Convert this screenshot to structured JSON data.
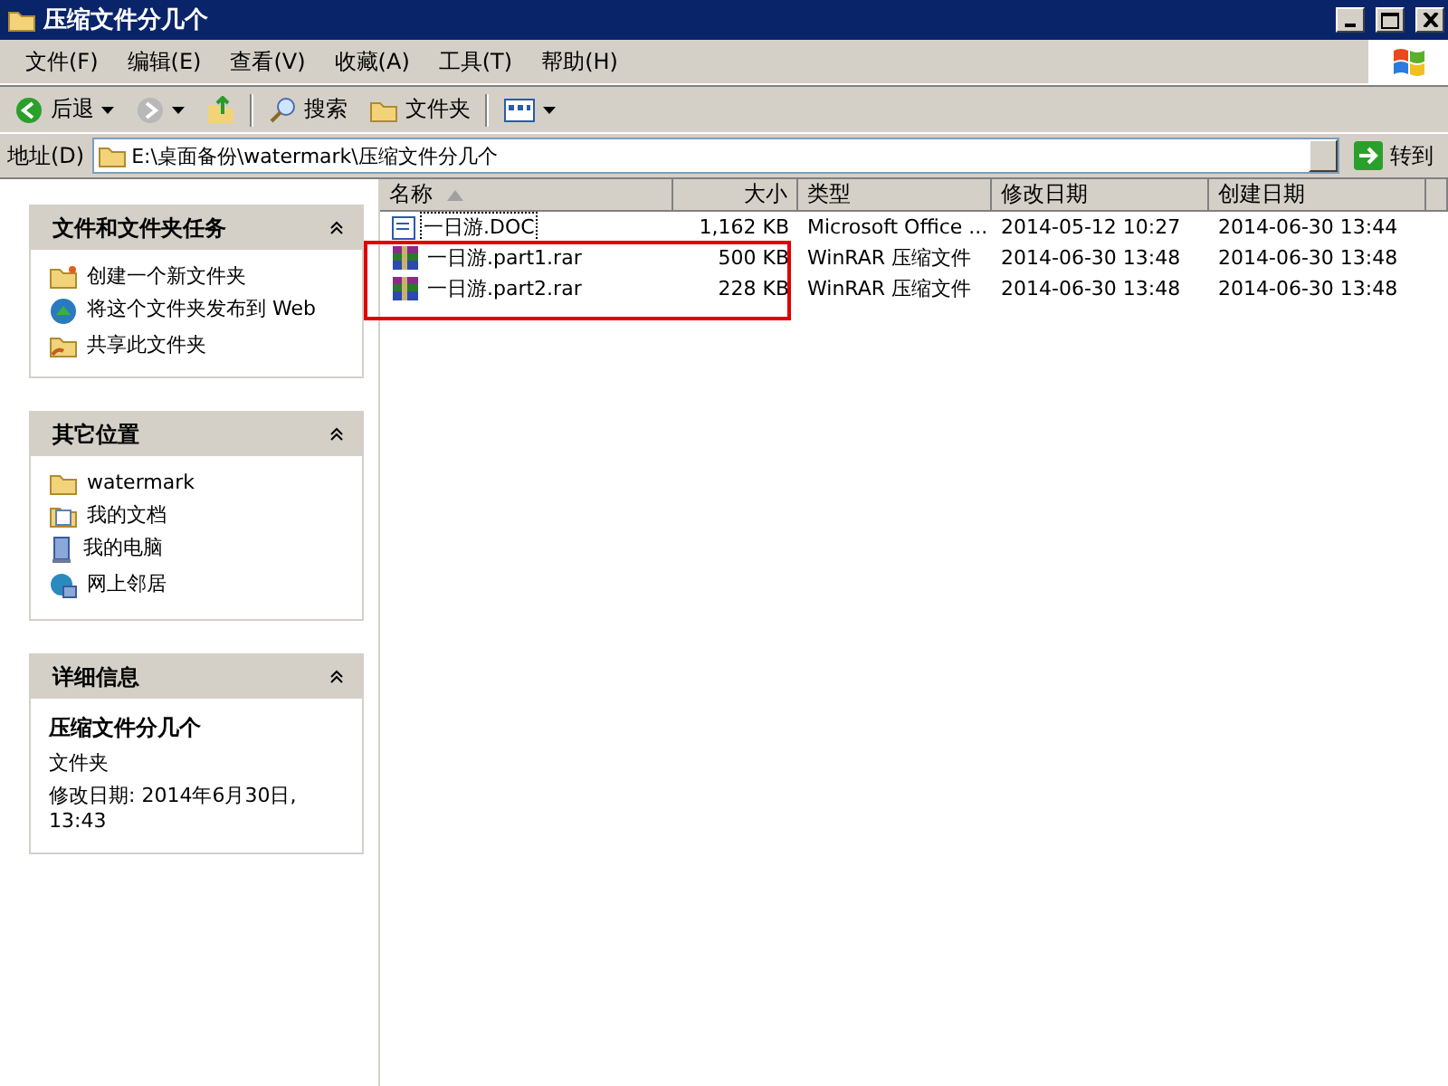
{
  "window": {
    "title": "压缩文件分几个"
  },
  "menu": [
    "文件(F)",
    "编辑(E)",
    "查看(V)",
    "收藏(A)",
    "工具(T)",
    "帮助(H)"
  ],
  "toolbar": {
    "back": "后退",
    "search": "搜索",
    "folders": "文件夹"
  },
  "address": {
    "label": "地址(D)",
    "value": "E:\\桌面备份\\watermark\\压缩文件分几个",
    "go": "转到"
  },
  "panels": [
    {
      "title": "文件和文件夹任务",
      "expanded": true,
      "items": [
        {
          "kind": "new-folder",
          "label": "创建一个新文件夹"
        },
        {
          "kind": "publish",
          "label": "将这个文件夹发布到 Web"
        },
        {
          "kind": "share",
          "label": "共享此文件夹"
        }
      ]
    },
    {
      "title": "其它位置",
      "expanded": true,
      "items": [
        {
          "kind": "folder",
          "label": "watermark"
        },
        {
          "kind": "documents",
          "label": "我的文档"
        },
        {
          "kind": "computer",
          "label": "我的电脑"
        },
        {
          "kind": "network",
          "label": "网上邻居"
        }
      ]
    },
    {
      "title": "详细信息",
      "expanded": true,
      "details": {
        "name": "压缩文件分几个",
        "type": "文件夹",
        "modified": "修改日期: 2014年6月30日, 13:43"
      }
    }
  ],
  "table": {
    "columns": [
      "名称",
      "大小",
      "类型",
      "修改日期",
      "创建日期"
    ],
    "annotation_frame": true,
    "rows": [
      {
        "kind": "doc",
        "name": "一日游.DOC",
        "size": "1,162 KB",
        "type": "Microsoft Office ...",
        "modified": "2014-05-12 10:27",
        "created": "2014-06-30 13:44",
        "focused": true
      },
      {
        "kind": "rar",
        "name": "一日游.part1.rar",
        "size": "500 KB",
        "type": "WinRAR 压缩文件",
        "modified": "2014-06-30 13:48",
        "created": "2014-06-30 13:48",
        "focused": false
      },
      {
        "kind": "rar",
        "name": "一日游.part2.rar",
        "size": "228 KB",
        "type": "WinRAR 压缩文件",
        "modified": "2014-06-30 13:48",
        "created": "2014-06-30 13:48",
        "focused": false
      }
    ]
  }
}
